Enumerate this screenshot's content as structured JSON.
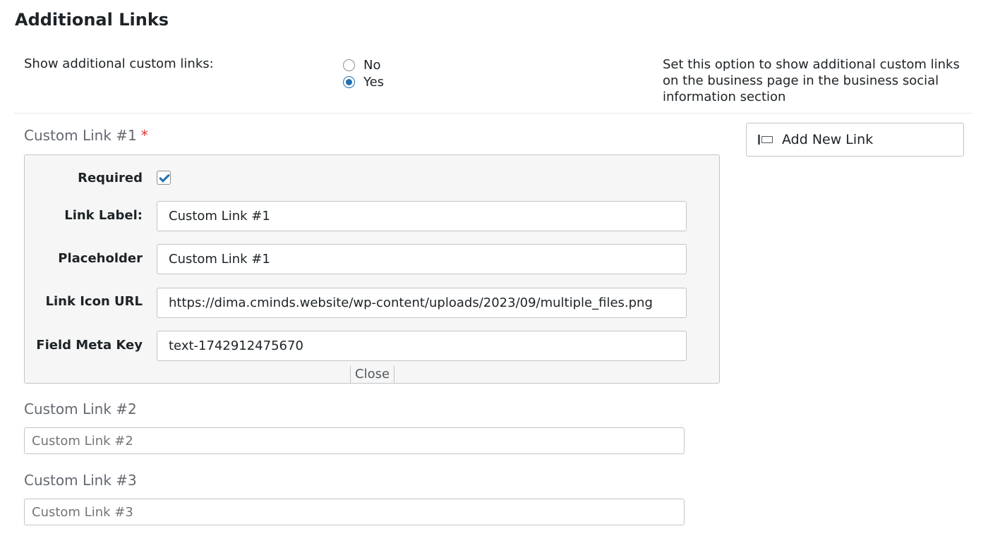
{
  "section": {
    "title": "Additional Links"
  },
  "show_links": {
    "label": "Show additional custom links:",
    "options": [
      {
        "label": "No",
        "checked": false
      },
      {
        "label": "Yes",
        "checked": true
      }
    ],
    "description": "Set this option to show additional custom links on the business page in the business social information section"
  },
  "add_button": {
    "label": "Add New Link",
    "icon": "add-link-icon"
  },
  "link1": {
    "title": "Custom Link #1",
    "required_star": "*",
    "required_label": "Required",
    "required_checked": true,
    "link_label_label": "Link Label:",
    "link_label_value": "Custom Link #1",
    "placeholder_label": "Placeholder",
    "placeholder_value": "Custom Link #1",
    "icon_url_label": "Link Icon URL",
    "icon_url_value": "https://dima.cminds.website/wp-content/uploads/2023/09/multiple_files.png",
    "meta_key_label": "Field Meta Key",
    "meta_key_value": "text-1742912475670",
    "close_label": "Close"
  },
  "link2": {
    "title": "Custom Link #2",
    "placeholder": "Custom Link #2"
  },
  "link3": {
    "title": "Custom Link #3",
    "placeholder": "Custom Link #3"
  },
  "colors": {
    "accent": "#2271b1",
    "required": "#d63638"
  }
}
